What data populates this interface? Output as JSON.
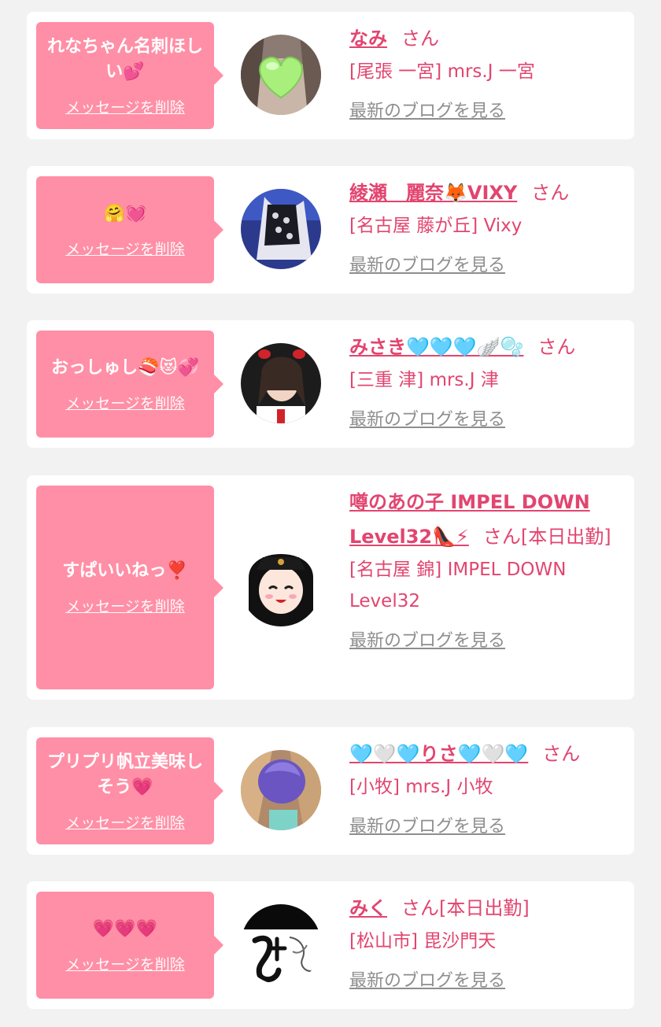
{
  "delete_label": "メッセージを削除",
  "san_label": "さん",
  "blog_label": "最新のブログを見る",
  "colors": {
    "page_bg": "#f2f2f2",
    "bubble": "#ff8fa6",
    "accent": "#e2456f",
    "muted": "#8e8e8e"
  },
  "entries": [
    {
      "message": "れなちゃん名刺ほしい💕",
      "name": "なみ",
      "status": "",
      "shop": "[尾張 一宮] mrs.J 一宮",
      "avatar_icon": "heart-sticker-avatar"
    },
    {
      "message": "🤗💓",
      "name": "綾瀬　麗奈🦊VIXY",
      "status": "",
      "shop": "[名古屋 藤が丘] Vixy",
      "avatar_icon": "lace-outfit-avatar"
    },
    {
      "message": "おっしゅし🍣😻💞",
      "name": "みさき🩵🩵🩵🪽🫧",
      "status": "",
      "shop": "[三重 津] mrs.J 津",
      "avatar_icon": "selfie-avatar"
    },
    {
      "message": "すぱいいねっ❣️",
      "name": "噂のあの子 IMPEL DOWN Level32👠⚡",
      "status": "[本日出勤]",
      "shop": "[名古屋 錦] IMPEL DOWN Level32",
      "avatar_icon": "illustrated-police-girl-avatar"
    },
    {
      "message": "プリプリ帆立美味しそう💗",
      "name": "🩵🤍🩵りさ🩵🤍🩵",
      "status": "",
      "shop": "[小牧] mrs.J 小牧",
      "avatar_icon": "masked-face-avatar"
    },
    {
      "message": "💗💗💗",
      "name": "みく",
      "status": "[本日出勤]",
      "shop": "[松山市] 毘沙門天",
      "avatar_icon": "calligraphy-logo-avatar"
    }
  ]
}
